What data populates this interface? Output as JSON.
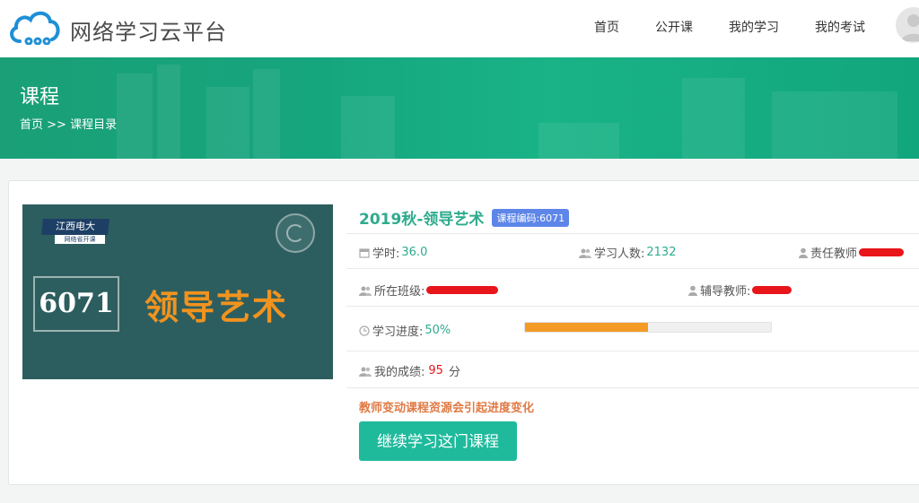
{
  "brand": {
    "name": "网络学习云平台",
    "logo_icon": "cloud-logo-icon",
    "color": "#1e8fd6"
  },
  "nav": {
    "items": [
      {
        "label": "首页"
      },
      {
        "label": "公开课"
      },
      {
        "label": "我的学习"
      },
      {
        "label": "我的考试"
      }
    ],
    "avatar_icon": "user-avatar-icon"
  },
  "banner": {
    "title": "课程",
    "breadcrumb": {
      "home": "首页",
      "separator": ">>",
      "current": "课程目录"
    },
    "color": "#16a67e"
  },
  "course": {
    "cover": {
      "school_tag": "江西电大",
      "school_sub": "网络省开课",
      "code": "6071",
      "name": "领导艺术",
      "bg_color": "#2d5e5f",
      "name_color": "#f1931f"
    },
    "title": "2019秋-领导艺术",
    "code_badge": "课程编码:6071",
    "hours": {
      "label": "学时:",
      "value": "36.0"
    },
    "students": {
      "label": "学习人数:",
      "value": "2132"
    },
    "teacher": {
      "label": "责任教师"
    },
    "class": {
      "label": "所在班级:"
    },
    "tutor": {
      "label": "辅导教师:"
    },
    "progress": {
      "label": "学习进度:",
      "value": "50%",
      "fraction": 0.5,
      "color": "#f39b25"
    },
    "score": {
      "label": "我的成绩:",
      "value": "95",
      "unit": "分"
    },
    "notice": "教师变动课程资源会引起进度变化",
    "continue_button": "继续学习这门课程",
    "accent_color": "#2eab8e",
    "button_color": "#1fba9c"
  }
}
